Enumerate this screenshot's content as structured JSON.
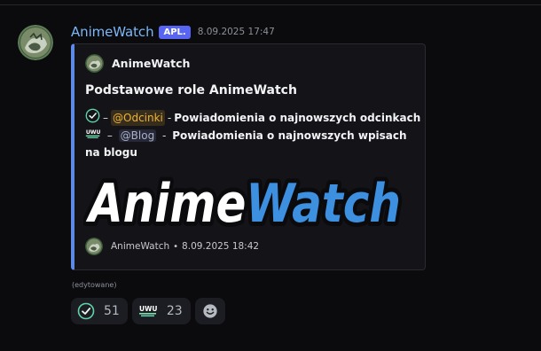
{
  "message": {
    "author": "AnimeWatch",
    "app_badge": "APL.",
    "timestamp": "8.09.2025 17:47",
    "edited_label": "(edytowane)"
  },
  "embed": {
    "author_name": "AnimeWatch",
    "title": "Podstawowe role AnimeWatch",
    "accent_color": "#5c8ae6",
    "lines": [
      {
        "icon": "check-circle-icon",
        "dash": "–",
        "role": "@Odcinki",
        "role_color": "#f0b232",
        "sep": "-",
        "text": "Powiadomienia o najnowszych odcinkach"
      },
      {
        "icon": "uwu-icon",
        "dash": "–",
        "role": "@Blog",
        "role_color": "#aab1c6",
        "sep": "-",
        "text": "Powiadomienia o najnowszych wpisach na blogu"
      }
    ],
    "banner": {
      "word_white": "Anime",
      "word_blue": "Watch"
    },
    "footer": {
      "name": "AnimeWatch",
      "separator": "•",
      "timestamp": "8.09.2025 18:42"
    }
  },
  "reactions": [
    {
      "icon": "check-circle-icon",
      "count": "51"
    },
    {
      "icon": "uwu-icon",
      "count": "23"
    }
  ],
  "add_reaction_icon": "smiley-icon"
}
